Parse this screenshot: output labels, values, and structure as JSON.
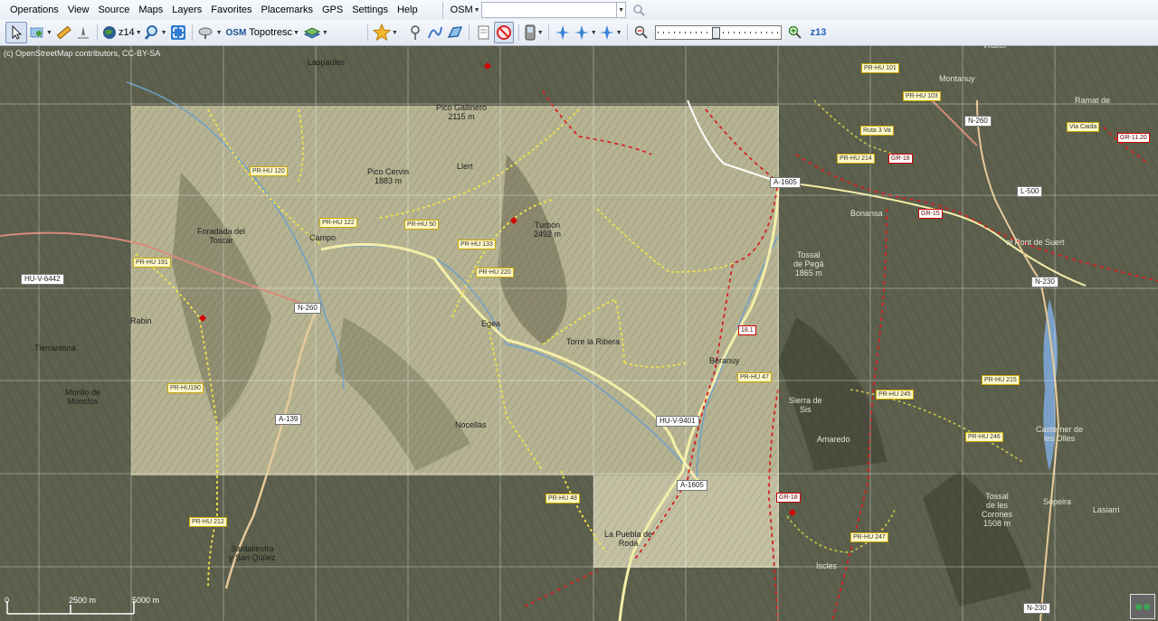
{
  "menubar": {
    "items": [
      "Operations",
      "View",
      "Source",
      "Maps",
      "Layers",
      "Favorites",
      "Placemarks",
      "GPS",
      "Settings",
      "Help"
    ],
    "source_select": "OSM",
    "search_value": ""
  },
  "toolbar": {
    "zoom_label": "z14",
    "map_source_label": "Topotresc",
    "osm_badge": "OSM",
    "zoom_level_text": "z13",
    "zoom_slider_level": 0.48
  },
  "map": {
    "attribution": "(c) OpenStreetMap contributors, CC-BY-SA",
    "scale": {
      "mid": "2500 m",
      "end": "5000 m",
      "start": "0"
    },
    "places": [
      {
        "t": "Laspaúles"
      },
      {
        "t": "Montanuy"
      },
      {
        "t": "Vilaller"
      },
      {
        "t": "Ramat de"
      },
      {
        "t": "Pico Gallinero\n2115 m"
      },
      {
        "t": "Pico Cervin\n1883 m"
      },
      {
        "t": "Llert"
      },
      {
        "t": "Turbón\n2492 m"
      },
      {
        "t": "Foradada del\nToscar"
      },
      {
        "t": "Campo"
      },
      {
        "t": "Bonansa"
      },
      {
        "t": "el Pont de Suert"
      },
      {
        "t": "Tossal\nde Pegà\n1865 m"
      },
      {
        "t": "Rabin"
      },
      {
        "t": "Tierrantona"
      },
      {
        "t": "Egea"
      },
      {
        "t": "Torre la Ribera"
      },
      {
        "t": "Beranuy"
      },
      {
        "t": "Morillo de\nMonclús"
      },
      {
        "t": "Nocellas"
      },
      {
        "t": "Sierra de\nSis"
      },
      {
        "t": "Amaredo"
      },
      {
        "t": "Casterner de\nles Olles"
      },
      {
        "t": "Santaliestra\ny San Quílez"
      },
      {
        "t": "La Puebla de\nRoda"
      },
      {
        "t": "Tossal\nde les\nCorones\n1508 m"
      },
      {
        "t": "Sopeira"
      },
      {
        "t": "Lasiarri"
      },
      {
        "t": "Iscles"
      }
    ],
    "trails": [
      {
        "t": "PR-HU 120"
      },
      {
        "t": "PR-HU 122"
      },
      {
        "t": "PR-HU 50"
      },
      {
        "t": "PR-HU 133"
      },
      {
        "t": "PR-HU 220"
      },
      {
        "t": "PR-HU 191"
      },
      {
        "t": "PR-HU190"
      },
      {
        "t": "PR-HU 48"
      },
      {
        "t": "PR-HU 212"
      },
      {
        "t": "PR-HU 101"
      },
      {
        "t": "PR-HU 103"
      },
      {
        "t": "PR-HU 214"
      },
      {
        "t": "PR-HU 47"
      },
      {
        "t": "PR-HU 245"
      },
      {
        "t": "PR-HU 246"
      },
      {
        "t": "PR-HU 215"
      },
      {
        "t": "PR-HU 247"
      },
      {
        "t": "Ruta 3 Va"
      },
      {
        "t": "Via Caida"
      }
    ],
    "red_trails": [
      {
        "t": "GR-18"
      },
      {
        "t": "GR-15"
      },
      {
        "t": "18.1"
      },
      {
        "t": "GR-18"
      },
      {
        "t": "GR-11.20"
      }
    ],
    "roads": [
      {
        "t": "A-1605"
      },
      {
        "t": "N-260"
      },
      {
        "t": "L-500"
      },
      {
        "t": "N-230"
      },
      {
        "t": "HU-V-6442"
      },
      {
        "t": "N-260"
      },
      {
        "t": "A-139"
      },
      {
        "t": "HU-V-9401"
      },
      {
        "t": "A-1605"
      },
      {
        "t": "N-230"
      }
    ]
  },
  "colors": {
    "trail_yellow": "#f2e24a",
    "trail_red": "#d42020",
    "road_main": "#f4eea8"
  }
}
